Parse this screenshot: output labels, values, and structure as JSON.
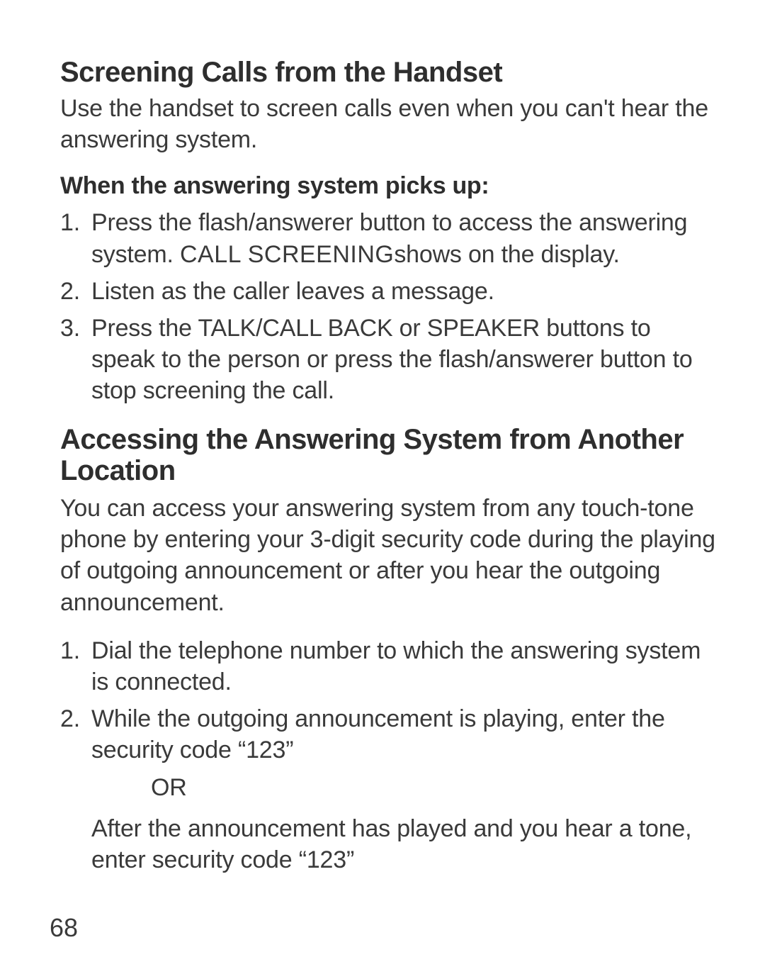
{
  "section1": {
    "heading": "Screening Calls from the Handset",
    "intro": "Use the handset to screen calls even when you can't hear the answering system.",
    "subheading": "When the answering system picks up:",
    "steps": [
      {
        "pre": "Press the flash/answerer button to access the answering system. ",
        "display": "CALL SCREENING",
        "post": "shows on the display."
      },
      {
        "text": "Listen as the caller leaves a message."
      },
      {
        "text": "Press the TALK/CALL BACK or SPEAKER buttons to speak to the person or press the flash/answerer button to stop screening the call."
      }
    ]
  },
  "section2": {
    "heading": "Accessing the Answering System from Another Location",
    "intro": "You can access your answering system from any touch-tone phone by entering your 3-digit security code during the playing of outgoing announcement or after you hear the outgoing announcement.",
    "steps": [
      {
        "text": "Dial the telephone number to which the answering system is connected."
      },
      {
        "text": "While the outgoing announcement is playing, enter the security code “123”",
        "or": "OR",
        "alt": "After the announcement has played and you hear a tone, enter security code “123”"
      }
    ]
  },
  "page_number": "68"
}
